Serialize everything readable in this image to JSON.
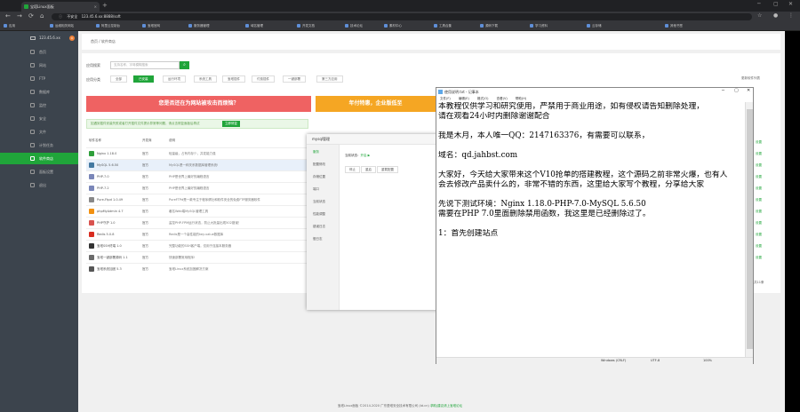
{
  "browser": {
    "tab_title": "宝塔Linux面板",
    "url": "123.45.6.xx:8888/soft",
    "url_prefix": "不安全",
    "bookmarks": [
      "应用",
      "运维相关网站",
      "阿里云控制台",
      "宝塔官网",
      "服务器管理",
      "域名管理",
      "开发文档",
      "技术论坛",
      "素材中心",
      "工具合集",
      "源码下载",
      "学习资料",
      "云存储",
      "其他书签"
    ]
  },
  "sidebar": {
    "server": "123.45.6.xx",
    "badge": "0",
    "items": [
      "首页",
      "网站",
      "FTP",
      "数据库",
      "监控",
      "安全",
      "文件",
      "计划任务",
      "软件商店",
      "面板设置",
      "退出"
    ],
    "active_index": 8
  },
  "breadcrumb": "首页 / 软件商店",
  "store": {
    "search_label": "应用搜索",
    "search_placeholder": "支持名称、字母模糊搜索",
    "category_label": "应用分类",
    "categories": [
      "全部",
      "已安装",
      "运行环境",
      "系统工具",
      "宝塔插件",
      "付费插件",
      "一键部署",
      "第三方应用"
    ],
    "category_active": 1,
    "category_right": "更新软件列表",
    "promo_left": "您是否还在为网站被攻击而烦恼？",
    "promo_right": "年付特惠，企业版低至",
    "notice": "如遇到插件安装失败或者打开插件文件提示异常等问题，请点击修复面板后再试",
    "notice_link": "立即修复",
    "columns": [
      "软件名称",
      "开发商",
      "说明"
    ],
    "rows": [
      {
        "name": "Nginx 1.18.0",
        "dev": "官方",
        "desc": "轻量级，占有内存少，并发能力强"
      },
      {
        "name": "MySQL 5.6.50",
        "dev": "官方",
        "desc": "MySQL是一种关系数据库管理系统!"
      },
      {
        "name": "PHP-7.0",
        "dev": "官方",
        "desc": "PHP是世界上最好的编程语言"
      },
      {
        "name": "PHP-7.2",
        "dev": "官方",
        "desc": "PHP是世界上最好的编程语言"
      },
      {
        "name": "Pure-Ftpd 1.0.49",
        "dev": "官方",
        "desc": "PureFTPd是一款专注于程序健壮和软件安全的免费FTP服务器软件"
      },
      {
        "name": "phpMyAdmin 4.7",
        "dev": "官方",
        "desc": "著名Web端MySQL管理工具"
      },
      {
        "name": "PHP守护 1.0",
        "dev": "官方",
        "desc": "监控PHP-FPM运行状态，防止大批量出现502错误！"
      },
      {
        "name": "Redis 5.0.8",
        "dev": "官方",
        "desc": "Redis是一个高性能的key-value数据库"
      },
      {
        "name": "宝塔SSH终端 1.0",
        "dev": "官方",
        "desc": "完整功能的SSH客户端，仅用于连接本服务器"
      },
      {
        "name": "宝塔一键部署源码 1.1",
        "dev": "官方",
        "desc": "快速部署常用程序!"
      },
      {
        "name": "宝塔系统加固 5.3",
        "dev": "官方",
        "desc": "宝塔Linux系统加固解决方案"
      }
    ],
    "row_links": [
      "设置",
      "设置",
      "设置",
      "设置",
      "设置",
      "设置",
      "设置",
      "设置",
      "设置",
      "设置",
      "设置"
    ],
    "pager": "共11条"
  },
  "mysql_dialog": {
    "title": "mysql管理",
    "nav": [
      "服务",
      "配置修改",
      "存储位置",
      "端口",
      "当前状态",
      "性能调整",
      "错误日志",
      "慢日志"
    ],
    "state_label": "当前状态：",
    "state_value": "开启",
    "buttons": [
      "停止",
      "重启",
      "重载配置"
    ]
  },
  "notepad": {
    "title": "使用说明.txt - 记事本",
    "menu": [
      "文件(F)",
      "编辑(E)",
      "格式(O)",
      "查看(V)",
      "帮助(H)"
    ],
    "lines": [
      "本教程仅供学习和研究使用，严禁用于商业用途，如有侵权请告知删除处理，",
      "请在观看24小时内删除谢谢配合",
      "",
      "我是木月，本人唯一QQ：2147163376，有需要可以联系，",
      "",
      "域名：qd.jahbst.com",
      "",
      "大家好，今天给大家带来这个V10抢单的搭建教程，这个源码之前非常火爆，也有人",
      "会去修改产品卖什么的，非常不错的东西，这里给大家写个教程，分享给大家",
      "",
      "先说下测试环境：Nginx 1.18.0-PHP-7.0-MySQL 5.6.50",
      "需要在PHP 7.0里面删除禁用函数，我这里是已经删除过了。",
      "",
      "1：首先创建站点"
    ],
    "status": [
      "Windows (CRLF)",
      "UTF-8",
      "100%"
    ]
  },
  "footer": {
    "text": "宝塔Linux面板 ©2014-2020 广东堡塔安全技术有限公司 (bt.cn)",
    "link": "求助|建议请上宝塔论坛"
  }
}
